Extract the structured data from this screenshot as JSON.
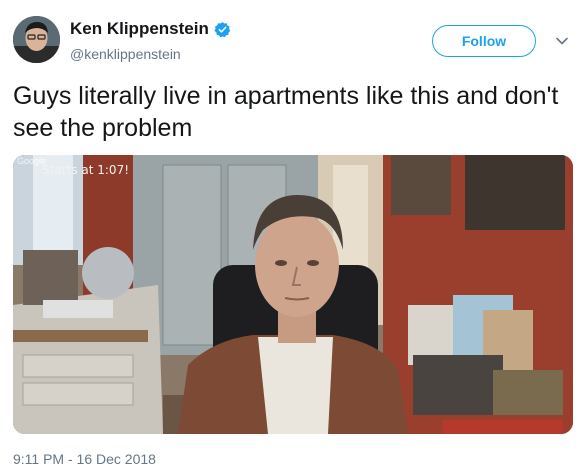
{
  "author": {
    "display_name": "Ken Klippenstein",
    "handle": "@kenklippenstein",
    "verified": true
  },
  "actions": {
    "follow_label": "Follow"
  },
  "tweet": {
    "text": "Guys literally live in apartments like this and don't see the problem",
    "timestamp": "9:11 PM - 16 Dec 2018"
  },
  "media": {
    "watermark": "Google",
    "overlay_text": "Starts at 1:07!"
  },
  "icons": {
    "verified": "verified-badge-icon",
    "menu": "chevron-down-icon"
  },
  "colors": {
    "accent": "#1da1f2",
    "text": "#14171a",
    "secondary": "#657786"
  }
}
